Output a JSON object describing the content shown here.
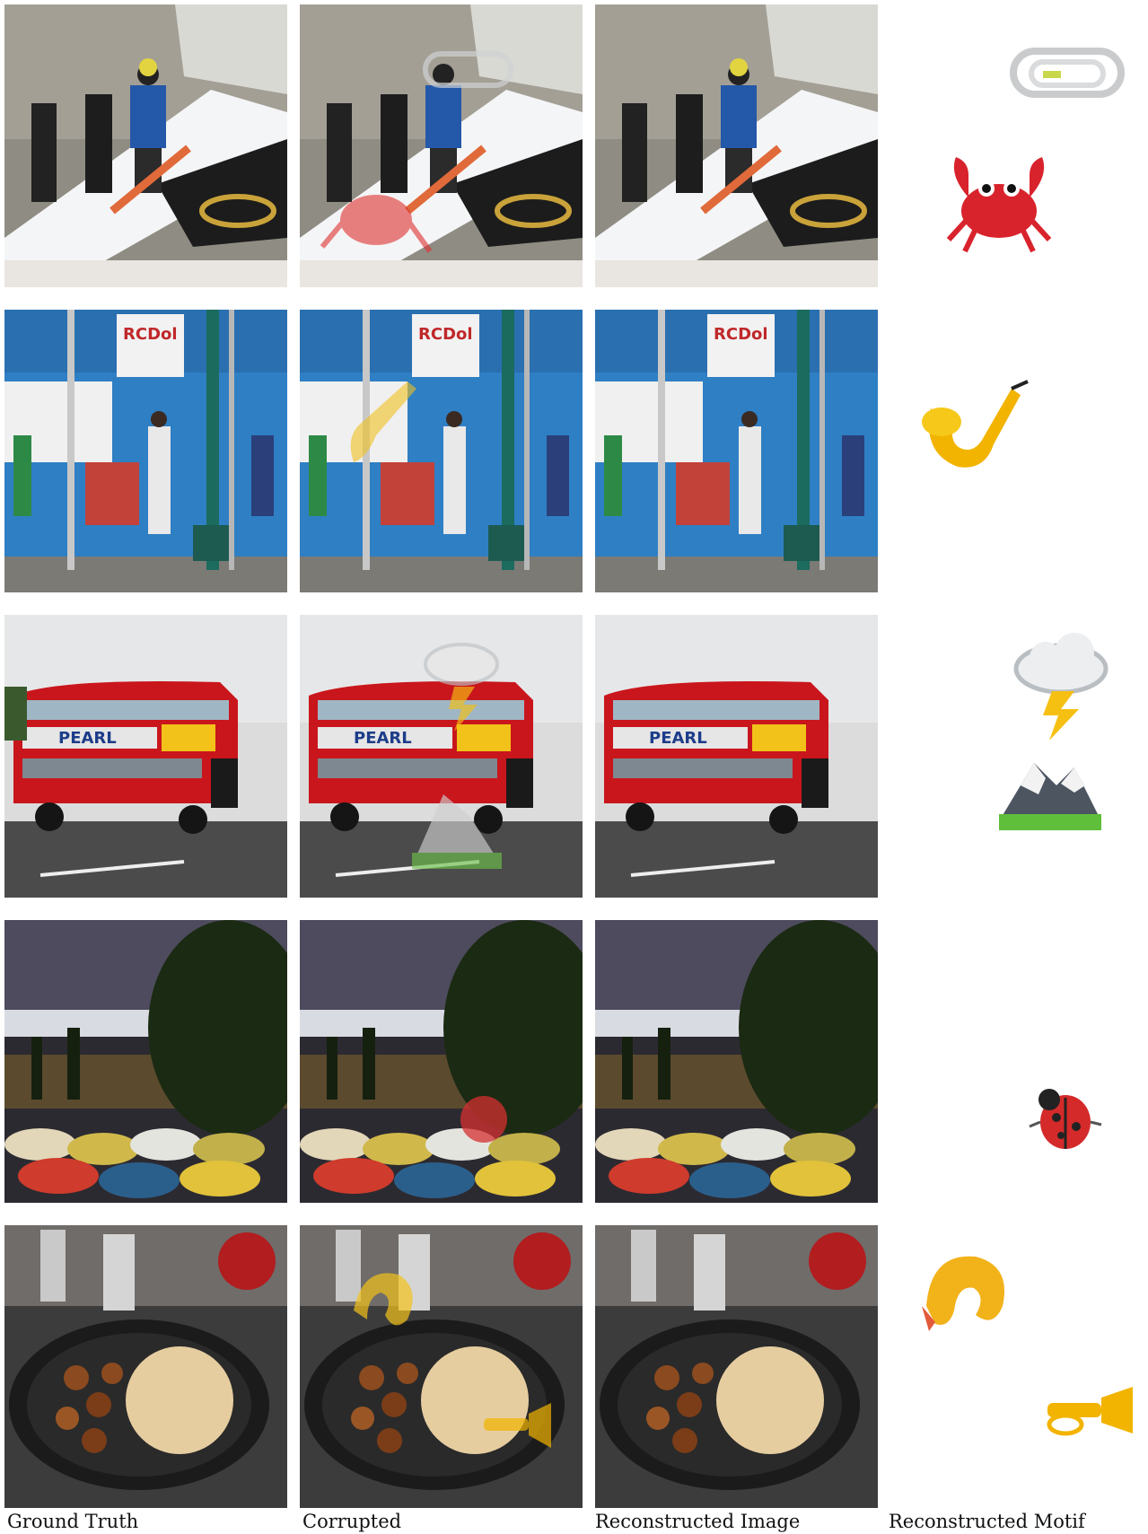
{
  "columns": [
    {
      "label": "Ground Truth"
    },
    {
      "label": "Corrupted"
    },
    {
      "label": "Reconstructed Image"
    },
    {
      "label": "Reconstructed Motif"
    }
  ],
  "rows": [
    {
      "scene": "snowboarder on snow ramp",
      "motifs": [
        "paperclip-icon",
        "crab-icon"
      ]
    },
    {
      "scene": "street with blue construction wall",
      "motifs": [
        "saxophone-icon"
      ],
      "sign_text": "RCDol"
    },
    {
      "scene": "red double-decker bus",
      "motifs": [
        "storm-cloud-icon",
        "mountain-icon"
      ],
      "bus_text": "PEARL"
    },
    {
      "scene": "city view with umbrellas",
      "motifs": [
        "ladybug-icon"
      ]
    },
    {
      "scene": "skillet with food",
      "motifs": [
        "shrimp-icon",
        "trumpet-icon"
      ]
    }
  ]
}
